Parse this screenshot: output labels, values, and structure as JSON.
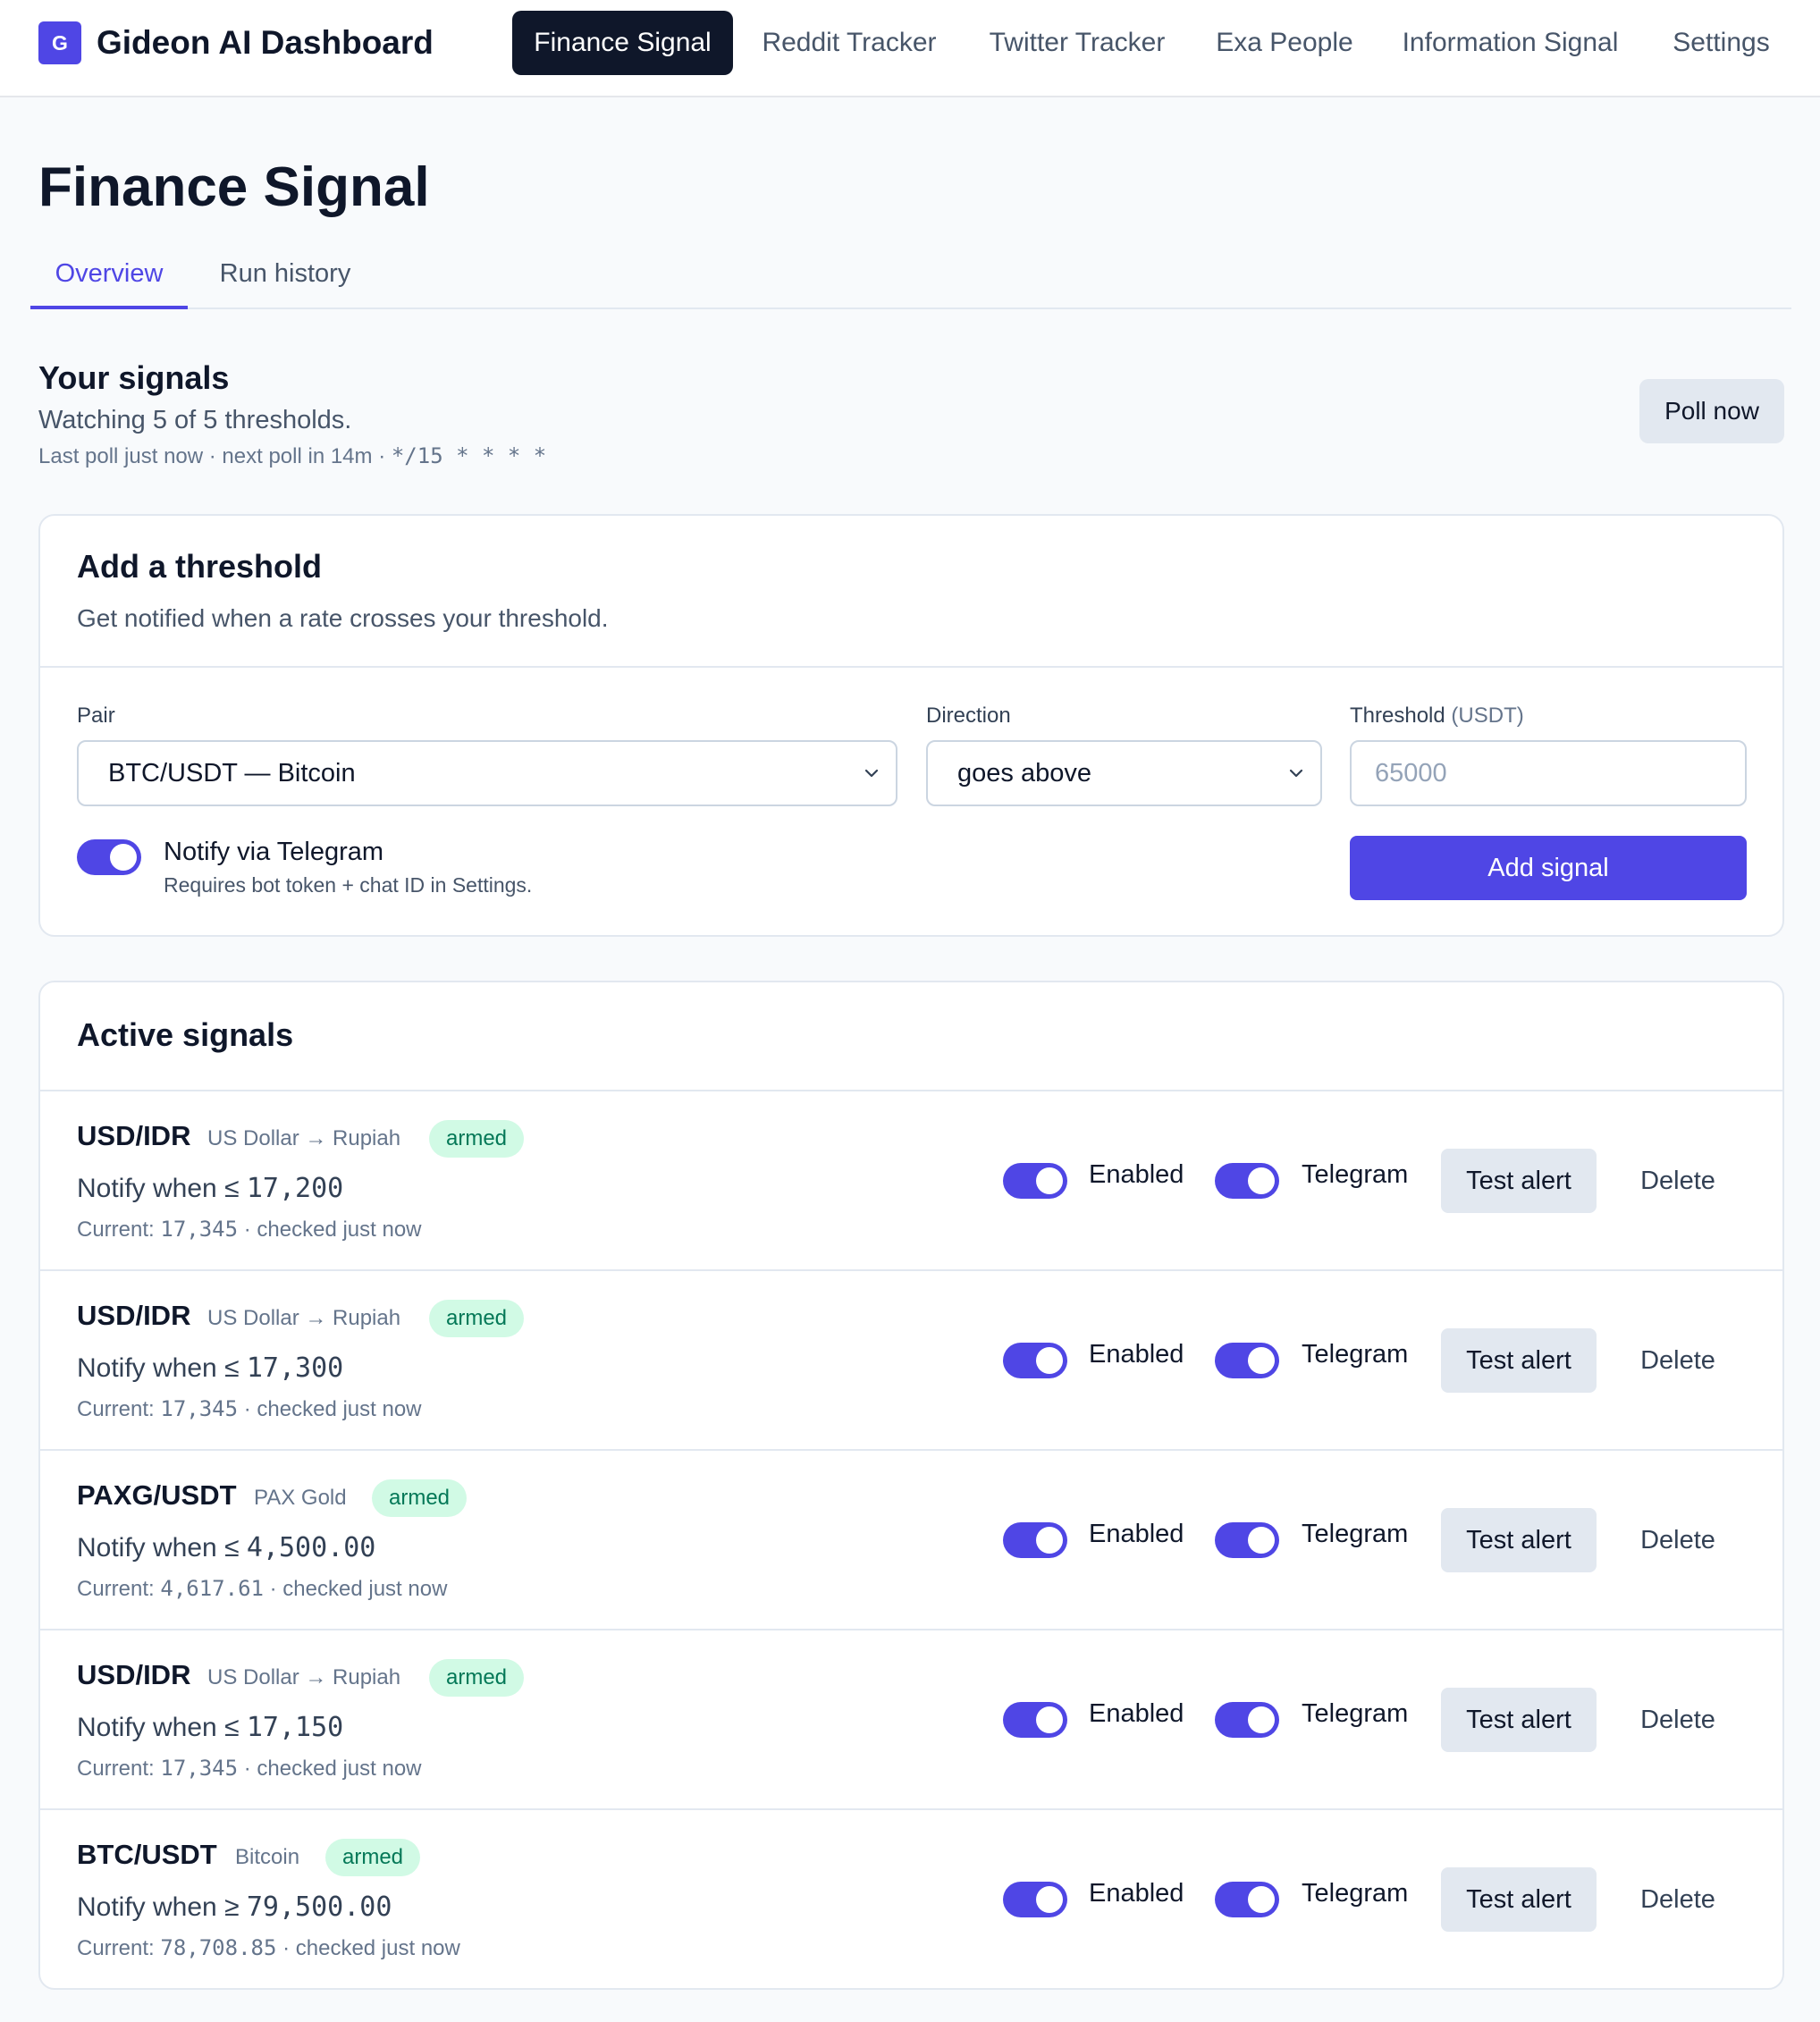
{
  "app": {
    "logo_letter": "G",
    "title": "Gideon AI Dashboard"
  },
  "nav": [
    {
      "label": "Finance Signal",
      "active": true
    },
    {
      "label": "Reddit Tracker"
    },
    {
      "label": "Twitter Tracker"
    },
    {
      "label": "Exa People"
    },
    {
      "label": "Information Signal"
    },
    {
      "label": "Settings"
    }
  ],
  "page": {
    "title": "Finance Signal",
    "tabs": [
      {
        "label": "Overview",
        "active": true
      },
      {
        "label": "Run history"
      }
    ]
  },
  "signals_header": {
    "heading": "Your signals",
    "watching": "Watching 5 of 5 thresholds.",
    "poll_info_prefix": "Last poll just now · next poll in 14m · ",
    "cron": "*/15 * * * *",
    "poll_button": "Poll now"
  },
  "add_threshold": {
    "title": "Add a threshold",
    "description": "Get notified when a rate crosses your threshold.",
    "pair_label": "Pair",
    "pair_value": "BTC/USDT — Bitcoin",
    "direction_label": "Direction",
    "direction_value": "goes above",
    "threshold_label": "Threshold",
    "threshold_unit": "(USDT)",
    "threshold_placeholder": "65000",
    "notify_label": "Notify via Telegram",
    "notify_hint": "Requires bot token + chat ID in Settings.",
    "notify_enabled": true,
    "add_button": "Add signal"
  },
  "active_signals": {
    "title": "Active signals",
    "enabled_label": "Enabled",
    "telegram_label": "Telegram",
    "test_button": "Test alert",
    "delete_button": "Delete",
    "rows": [
      {
        "pair": "USD/IDR",
        "subtitle": "US Dollar → Rupiah",
        "status": "armed",
        "rule_prefix": "Notify when ≤ ",
        "rule_value": "17,200",
        "current_prefix": "Current: ",
        "current_value": "17,345",
        "current_suffix": " · checked just now",
        "enabled": true,
        "telegram": true
      },
      {
        "pair": "USD/IDR",
        "subtitle": "US Dollar → Rupiah",
        "status": "armed",
        "rule_prefix": "Notify when ≤ ",
        "rule_value": "17,300",
        "current_prefix": "Current: ",
        "current_value": "17,345",
        "current_suffix": " · checked just now",
        "enabled": true,
        "telegram": true
      },
      {
        "pair": "PAXG/USDT",
        "subtitle": "PAX Gold",
        "status": "armed",
        "rule_prefix": "Notify when ≤ ",
        "rule_value": "4,500.00",
        "current_prefix": "Current: ",
        "current_value": "4,617.61",
        "current_suffix": " · checked just now",
        "enabled": true,
        "telegram": true
      },
      {
        "pair": "USD/IDR",
        "subtitle": "US Dollar → Rupiah",
        "status": "armed",
        "rule_prefix": "Notify when ≤ ",
        "rule_value": "17,150",
        "current_prefix": "Current: ",
        "current_value": "17,345",
        "current_suffix": " · checked just now",
        "enabled": true,
        "telegram": true
      },
      {
        "pair": "BTC/USDT",
        "subtitle": "Bitcoin",
        "status": "armed",
        "rule_prefix": "Notify when ≥ ",
        "rule_value": "79,500.00",
        "current_prefix": "Current: ",
        "current_value": "78,708.85",
        "current_suffix": " · checked just now",
        "enabled": true,
        "telegram": true
      }
    ]
  }
}
